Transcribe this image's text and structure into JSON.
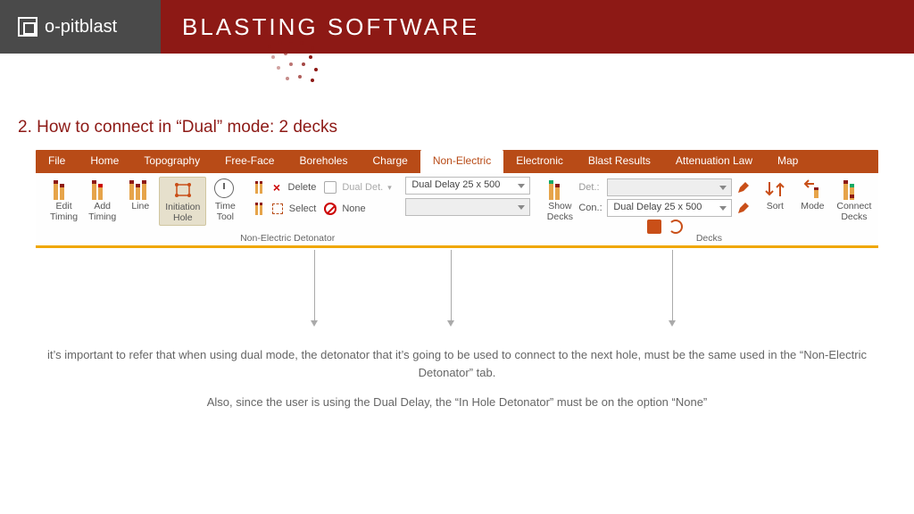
{
  "banner": {
    "logo_text": "o-pitblast",
    "title": "BLASTING SOFTWARE"
  },
  "section_title": "2. How to connect in “Dual” mode: 2 decks",
  "tabs": [
    "File",
    "Home",
    "Topography",
    "Free-Face",
    "Boreholes",
    "Charge",
    "Non-Electric",
    "Electronic",
    "Blast Results",
    "Attenuation Law",
    "Map"
  ],
  "active_tab": "Non-Electric",
  "toolbar": {
    "edit_timing": "Edit\nTiming",
    "add_timing": "Add\nTiming",
    "line": "Line",
    "initiation_hole": "Initiation\nHole",
    "time_tool": "Time\nTool",
    "delete": "Delete",
    "select": "Select",
    "dual_det": "Dual Det.",
    "none": "None",
    "group1_label": "Non-Electric Detonator",
    "dual_delay_value": "Dual Delay 25 x 500",
    "show_decks": "Show\nDecks",
    "det_label": "Det.:",
    "con_label": "Con.:",
    "con_value": "Dual Delay 25 x 500",
    "sort": "Sort",
    "mode": "Mode",
    "connect_decks": "Connect\nDecks",
    "group2_label": "Decks"
  },
  "notes": {
    "p1": "it’s important to refer that when using dual mode, the detonator that it’s going to be used to connect to the next hole, must be the same used in the “Non-Electric Detonator” tab.",
    "p2": "Also, since the user is using the Dual Delay, the “In Hole Detonator” must be on the option “None”"
  }
}
